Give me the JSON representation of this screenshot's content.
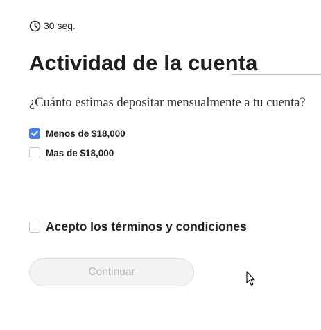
{
  "timer": {
    "icon": "clock-icon",
    "text": "30 seg."
  },
  "title": "Actividad de la cuenta",
  "question": "¿Cuánto estimas depositar mensualmente a tu cuenta?",
  "options": [
    {
      "label": "Menos de $18,000",
      "checked": true
    },
    {
      "label": "Mas de $18,000",
      "checked": false
    }
  ],
  "terms": {
    "label": "Acepto los términos y condiciones",
    "checked": false
  },
  "continue_button": {
    "label": "Continuar",
    "enabled": false
  },
  "colors": {
    "accent": "#4a7fe5",
    "disabled_button_bg": "#f3f3f3",
    "disabled_button_text": "#b5b5b5"
  }
}
